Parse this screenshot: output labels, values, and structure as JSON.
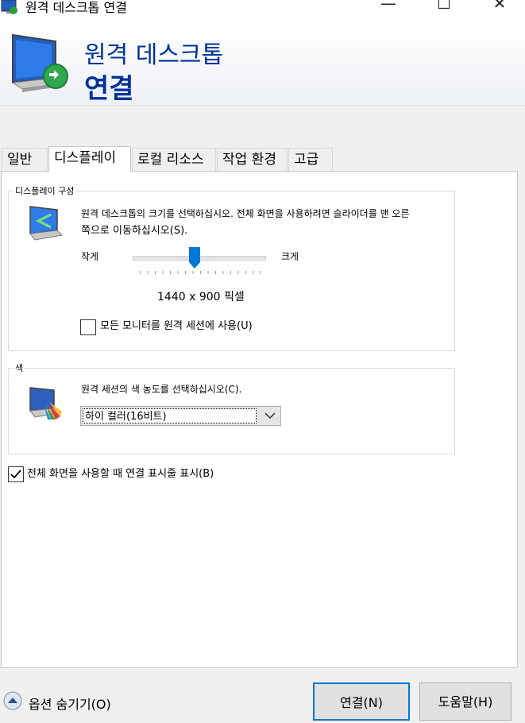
{
  "window": {
    "title": "원격 데스크톱 연결",
    "minimize": "—",
    "maximize": "☐",
    "close": "✕"
  },
  "banner": {
    "line1": "원격 데스크톱",
    "line2": "연결"
  },
  "tabs": [
    {
      "label": "일반"
    },
    {
      "label": "디스플레이",
      "active": true
    },
    {
      "label": "로컬 리소스"
    },
    {
      "label": "작업 환경"
    },
    {
      "label": "고급"
    }
  ],
  "display_config": {
    "group_title": "디스플레이 구성",
    "description_line1": "원격 데스크톱의 크기를 선택하십시오. 전체 화면을 사용하려면 슬라이더를 맨 오른",
    "description_line2": "쪽으로 이동하십시오(S).",
    "slider_min_label": "작게",
    "slider_max_label": "크게",
    "slider_position_fraction": 0.47,
    "resolution": "1440 x 900 픽셀",
    "all_monitors_label": "모든 모니터를 원격 세션에 사용(U)",
    "all_monitors_checked": false
  },
  "colors": {
    "group_title": "색",
    "description": "원격 세션의 색 농도를 선택하십시오(C).",
    "selected_depth": "하이 컬러(16비트)"
  },
  "connection_bar": {
    "label": "전체 화면을 사용할 때 연결 표시줄 표시(B)",
    "checked": true
  },
  "footer": {
    "options_label": "옵션 숨기기(O)",
    "connect_button": "연결(N)",
    "help_button": "도움말(H)"
  },
  "theme": {
    "banner_text_color": "#003399",
    "accent": "#0078d7"
  }
}
